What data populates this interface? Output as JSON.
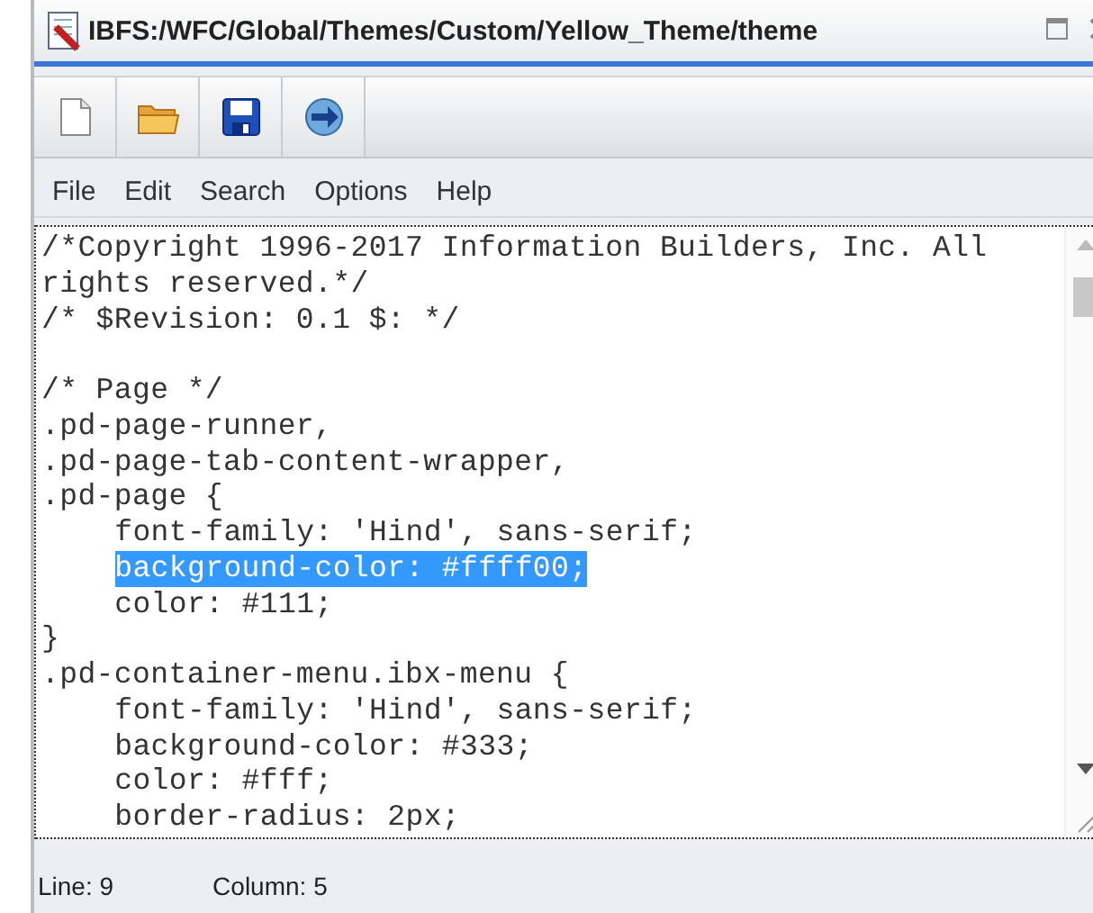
{
  "window": {
    "title": "IBFS:/WFC/Global/Themes/Custom/Yellow_Theme/theme"
  },
  "toolbar": [
    {
      "kind": "new"
    },
    {
      "kind": "open"
    },
    {
      "kind": "save"
    },
    {
      "kind": "forward"
    }
  ],
  "menu": [
    "File",
    "Edit",
    "Search",
    "Options",
    "Help"
  ],
  "editor": {
    "lines": [
      {
        "kind": "code",
        "text": "/*Copyright 1996-2017 Information Builders, Inc. All",
        "indented": false,
        "selected": false
      },
      {
        "kind": "code",
        "text": "rights reserved.*/",
        "indented": false,
        "selected": false
      },
      {
        "kind": "code",
        "text": "/* $Revision: 0.1 $: */",
        "indented": false,
        "selected": false
      },
      {
        "kind": "blank"
      },
      {
        "kind": "code",
        "text": "/* Page */",
        "indented": false,
        "selected": false
      },
      {
        "kind": "code",
        "text": ".pd-page-runner,",
        "indented": false,
        "selected": false
      },
      {
        "kind": "code",
        "text": ".pd-page-tab-content-wrapper,",
        "indented": false,
        "selected": false
      },
      {
        "kind": "code",
        "text": ".pd-page {",
        "indented": false,
        "selected": false
      },
      {
        "kind": "code",
        "text": "font-family: 'Hind', sans-serif;",
        "indented": true,
        "selected": false
      },
      {
        "kind": "code",
        "text": "background-color: #ffff00;",
        "indented": true,
        "selected": true
      },
      {
        "kind": "code",
        "text": "color: #111;",
        "indented": true,
        "selected": false
      },
      {
        "kind": "code",
        "text": "}",
        "indented": false,
        "selected": false
      },
      {
        "kind": "code",
        "text": ".pd-container-menu.ibx-menu {",
        "indented": false,
        "selected": false
      },
      {
        "kind": "code",
        "text": "font-family: 'Hind', sans-serif;",
        "indented": true,
        "selected": false
      },
      {
        "kind": "code",
        "text": "background-color: #333;",
        "indented": true,
        "selected": false
      },
      {
        "kind": "code",
        "text": "color: #fff;",
        "indented": true,
        "selected": false
      },
      {
        "kind": "code",
        "text": "border-radius: 2px;",
        "indented": true,
        "selected": false
      }
    ]
  },
  "status_bar": {
    "line": "Line: 9",
    "column": "Column: 5"
  }
}
